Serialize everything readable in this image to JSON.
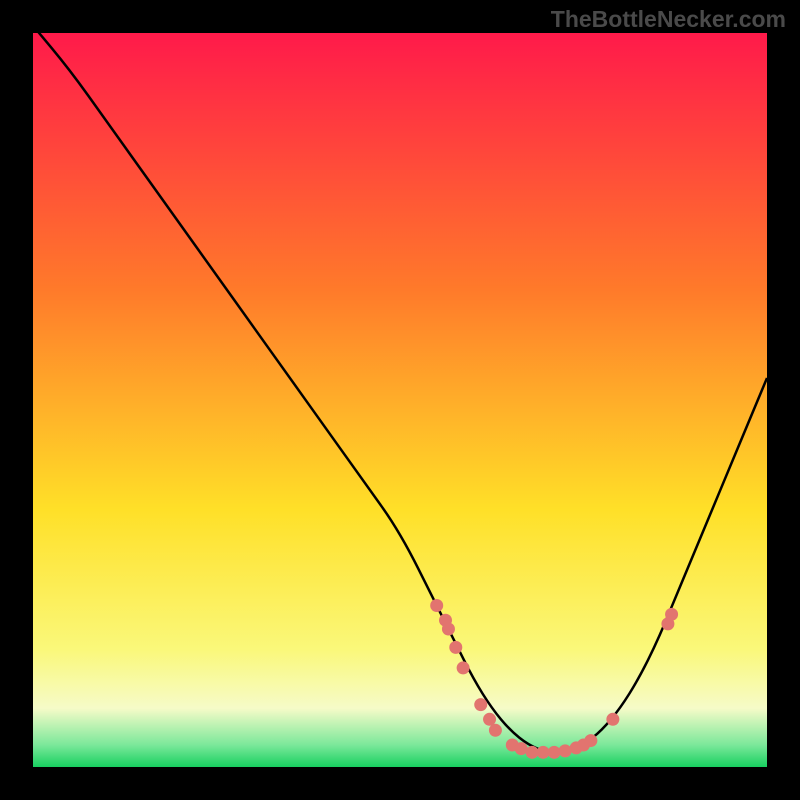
{
  "watermark": "TheBottleNecker.com",
  "chart_data": {
    "type": "line",
    "title": "",
    "xlabel": "",
    "ylabel": "",
    "xlim": [
      0,
      100
    ],
    "ylim": [
      0,
      100
    ],
    "series": [
      {
        "name": "curve",
        "x": [
          0,
          5,
          10,
          15,
          20,
          25,
          30,
          35,
          40,
          45,
          50,
          55,
          57.5,
          60,
          62.5,
          65,
          67.5,
          70,
          72.5,
          75,
          77.5,
          80,
          82.5,
          85,
          87.5,
          90,
          92.5,
          95,
          97.5,
          100
        ],
        "y": [
          101,
          95,
          88,
          81,
          74,
          67,
          60,
          53,
          46,
          39,
          32,
          22,
          17,
          12,
          8,
          5,
          3,
          2,
          2,
          3,
          5,
          8,
          12,
          17,
          23,
          29,
          35,
          41,
          47,
          53
        ]
      }
    ],
    "markers": [
      {
        "x": 55.0,
        "y": 22.0
      },
      {
        "x": 56.2,
        "y": 20.0
      },
      {
        "x": 56.6,
        "y": 18.8
      },
      {
        "x": 57.6,
        "y": 16.3
      },
      {
        "x": 58.6,
        "y": 13.5
      },
      {
        "x": 61.0,
        "y": 8.5
      },
      {
        "x": 62.2,
        "y": 6.5
      },
      {
        "x": 63.0,
        "y": 5.0
      },
      {
        "x": 65.3,
        "y": 3.0
      },
      {
        "x": 66.5,
        "y": 2.5
      },
      {
        "x": 68.0,
        "y": 2.0
      },
      {
        "x": 69.5,
        "y": 2.0
      },
      {
        "x": 71.0,
        "y": 2.0
      },
      {
        "x": 72.5,
        "y": 2.2
      },
      {
        "x": 74.0,
        "y": 2.6
      },
      {
        "x": 75.0,
        "y": 3.0
      },
      {
        "x": 76.0,
        "y": 3.6
      },
      {
        "x": 79.0,
        "y": 6.5
      },
      {
        "x": 86.5,
        "y": 19.5
      },
      {
        "x": 87.0,
        "y": 20.8
      }
    ],
    "marker_color": "#e2746f",
    "curve_color": "#000000",
    "gradient_stops": [
      {
        "offset": 0,
        "color": "#ff1a4a"
      },
      {
        "offset": 35,
        "color": "#ff7a2a"
      },
      {
        "offset": 65,
        "color": "#ffe028"
      },
      {
        "offset": 84,
        "color": "#faf87a"
      },
      {
        "offset": 92,
        "color": "#f6fbc8"
      },
      {
        "offset": 97,
        "color": "#7be89a"
      },
      {
        "offset": 100,
        "color": "#18d060"
      }
    ]
  }
}
